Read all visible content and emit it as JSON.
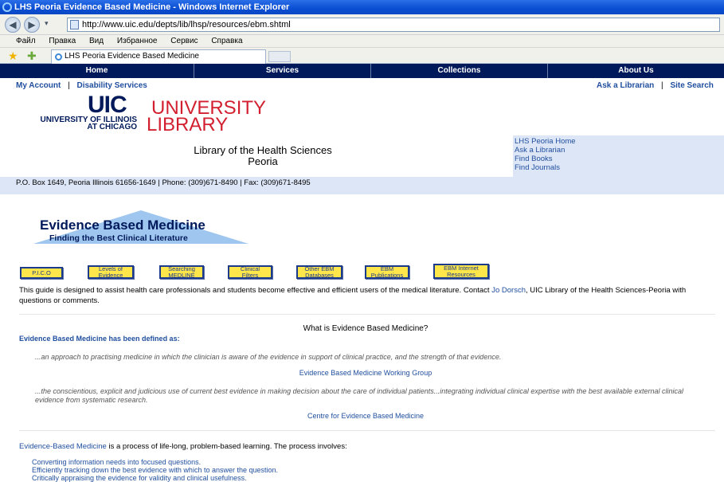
{
  "browser": {
    "title": "LHS Peoria Evidence Based Medicine - Windows Internet Explorer",
    "url": "http://www.uic.edu/depts/lib/lhsp/resources/ebm.shtml",
    "menu": [
      "Файл",
      "Правка",
      "Вид",
      "Избранное",
      "Сервис",
      "Справка"
    ],
    "tab_title": "LHS Peoria Evidence Based Medicine"
  },
  "site_nav": [
    "Home",
    "Services",
    "Collections",
    "About Us"
  ],
  "top_links": {
    "my_account": "My Account",
    "disability": "Disability Services",
    "ask": "Ask a Librarian",
    "search": "Site Search"
  },
  "logo": {
    "uic": "UIC",
    "university": "UNIVERSITY",
    "library": "LIBRARY",
    "line1": "UNIVERSITY OF ILLINOIS",
    "line2": "AT CHICAGO"
  },
  "lhs_title": {
    "line1": "Library of the Health Sciences",
    "line2": "Peoria"
  },
  "right_links": [
    "LHS Peoria Home",
    "Ask a Librarian",
    "Find Books",
    "Find Journals"
  ],
  "address": "P.O. Box 1649, Peoria Illinois 61656-1649 | Phone: (309)671-8490 | Fax: (309)671-8495",
  "ebm_banner": {
    "title": "Evidence Based Medicine",
    "subtitle": "Finding the Best Clinical Literature"
  },
  "guide_buttons": [
    {
      "line1": "P.I.C.O",
      "line2": ""
    },
    {
      "line1": "Levels of",
      "line2": "Evidence"
    },
    {
      "line1": "Searching",
      "line2": "MEDLINE"
    },
    {
      "line1": "Clinical",
      "line2": "Filters"
    },
    {
      "line1": "Other EBM",
      "line2": "Databases"
    },
    {
      "line1": "EBM",
      "line2": "Publications"
    },
    {
      "line1": "EBM Internet",
      "line2": "Resources"
    }
  ],
  "intro": {
    "before": "This guide is designed to assist health care professionals and students become effective and efficient users of the medical literature. Contact ",
    "contact": "Jo Dorsch",
    "after": ", UIC Library of the Health Sciences-Peoria with questions or comments."
  },
  "what_heading": "What is Evidence Based Medicine?",
  "defined_heading": "Evidence Based Medicine has been defined as:",
  "quote1": "...an approach to practising medicine in which the clinician is aware of the evidence in support of clinical practice, and the strength of that evidence.",
  "attr1": "Evidence Based Medicine Working Group",
  "quote2": "...the conscientious, explicit and judicious use of current best evidence in making decision about the care of individual patients...integrating individual clinical expertise with the best available external clinical evidence from systematic research.",
  "attr2": "Centre for Evidence Based Medicine",
  "process": {
    "link": "Evidence-Based Medicine",
    "text": " is a process of life-long, problem-based learning. The process involves:"
  },
  "steps": [
    "Converting information needs into focused questions.",
    "Efficiently tracking down the best evidence with which to answer the question.",
    "Critically appraising the evidence for validity and clinical usefulness."
  ]
}
